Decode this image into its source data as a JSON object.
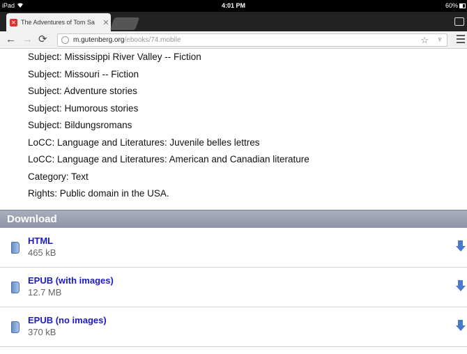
{
  "status_bar": {
    "device": "iPad",
    "time": "4:01 PM",
    "battery": "60%"
  },
  "tab": {
    "title": "The Adventures of Tom Sa"
  },
  "address_bar": {
    "domain": "m.gutenberg.org",
    "path": "/ebooks/74.mobile"
  },
  "metadata": [
    "Subject: Mississippi River Valley -- Fiction",
    "Subject: Missouri -- Fiction",
    "Subject: Adventure stories",
    "Subject: Humorous stories",
    "Subject: Bildungsromans",
    "LoCC: Language and Literatures: Juvenile belles lettres",
    "LoCC: Language and Literatures: American and Canadian literature",
    "Category: Text",
    "Rights: Public domain in the USA."
  ],
  "download": {
    "header": "Download",
    "items": [
      {
        "name": "HTML",
        "size": "465 kB"
      },
      {
        "name": "EPUB (with images)",
        "size": "12.7 MB"
      },
      {
        "name": "EPUB (no images)",
        "size": "370 kB"
      }
    ]
  },
  "colors": {
    "link": "#1a1ac8",
    "download_header": "#9a9fb2",
    "favicon": "#dd3333"
  }
}
